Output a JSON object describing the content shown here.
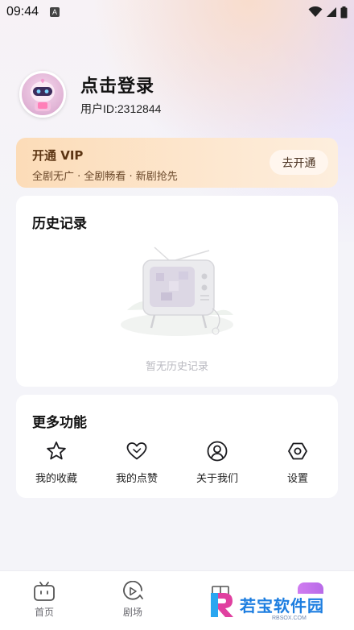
{
  "status_bar": {
    "time": "09:44",
    "notification_letter": "A",
    "icons": [
      "wifi-icon",
      "signal-icon",
      "battery-icon"
    ]
  },
  "profile": {
    "title": "点击登录",
    "user_id": "用户ID:2312844"
  },
  "vip": {
    "title": "开通 VIP",
    "subtitle": "全剧无广 · 全剧畅看 · 新剧抢先",
    "button_label": "去开通"
  },
  "history": {
    "title": "历史记录",
    "empty_text": "暂无历史记录"
  },
  "more": {
    "title": "更多功能",
    "items": [
      {
        "label": "我的收藏",
        "icon": "star-icon"
      },
      {
        "label": "我的点赞",
        "icon": "heart-icon"
      },
      {
        "label": "关于我们",
        "icon": "user-icon"
      },
      {
        "label": "设置",
        "icon": "settings-icon"
      }
    ]
  },
  "nav": {
    "items": [
      {
        "label": "首页",
        "icon": "tv-home-icon"
      },
      {
        "label": "剧场",
        "icon": "play-circle-icon"
      }
    ]
  },
  "watermark": {
    "text": "若宝软件园",
    "sub": "RBSOX.COM"
  },
  "colors": {
    "accent_vip": "#fcdcb8",
    "background": "#f4f4f9"
  }
}
